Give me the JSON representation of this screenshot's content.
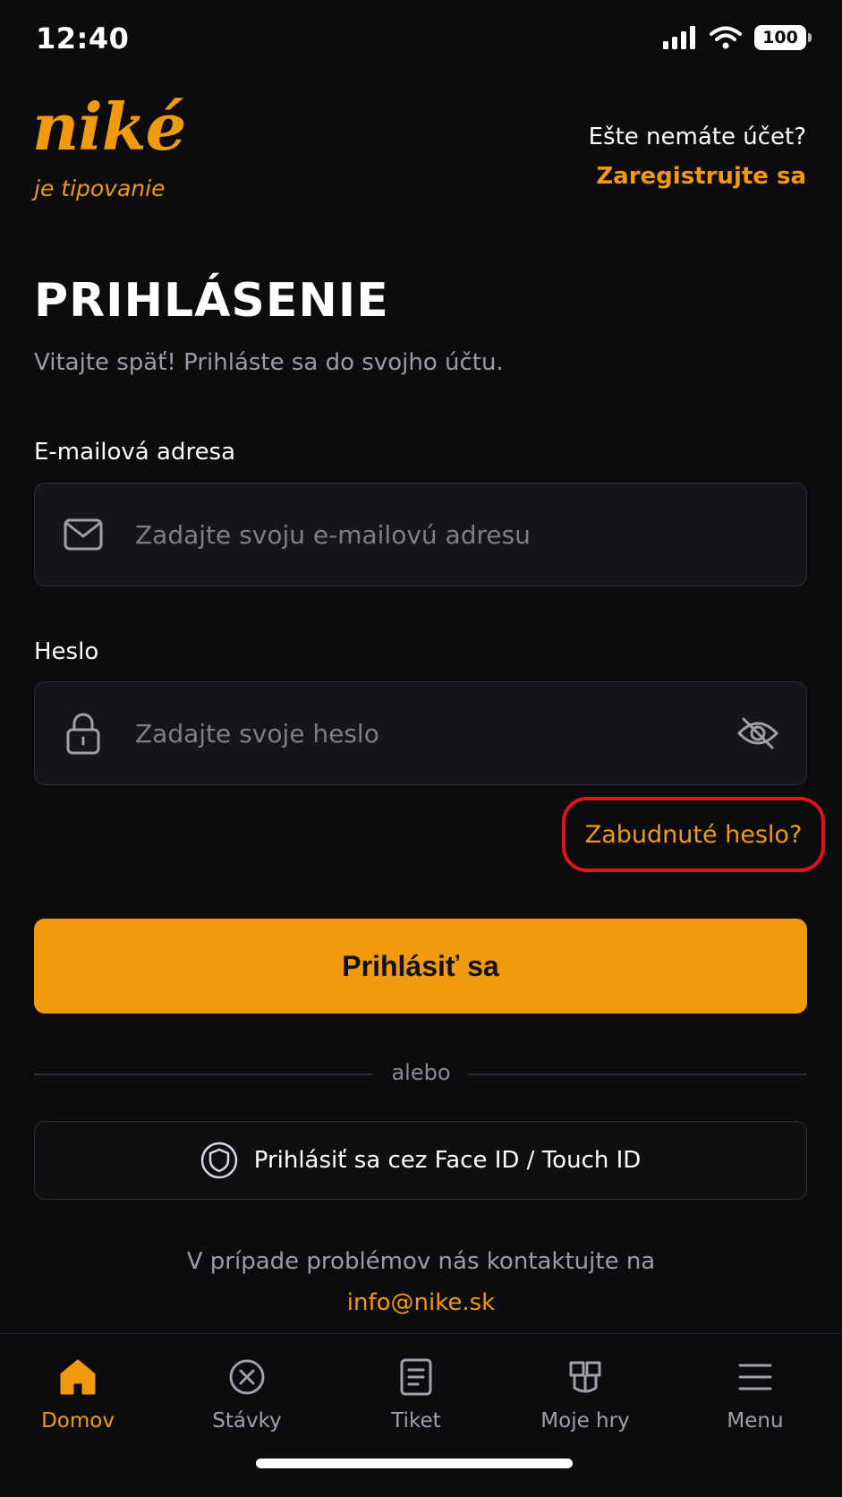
{
  "status_bar": {
    "time": "12:40",
    "battery": "100"
  },
  "header": {
    "logo": "niké",
    "logo_tagline": "je tipovanie",
    "no_account": "Ešte nemáte účet?",
    "register": "Zaregistrujte sa"
  },
  "login": {
    "title": "PRIHLÁSENIE",
    "subtitle": "Vitajte späť! Prihláste sa do svojho účtu.",
    "email_label": "E-mailová adresa",
    "email_placeholder": "Zadajte svoju e-mailovú adresu",
    "password_label": "Heslo",
    "password_placeholder": "Zadajte svoje heslo",
    "forgot_password": "Zabudnuté heslo?",
    "submit": "Prihlásiť sa",
    "divider": "alebo",
    "biometric": "Prihlásiť sa cez Face ID / Touch ID",
    "contact_text": "V prípade problémov nás kontaktujte na",
    "contact_email": "info@nike.sk"
  },
  "nav": {
    "items": [
      {
        "label": "Domov",
        "icon": "home-icon",
        "active": true
      },
      {
        "label": "Stávky",
        "icon": "close-circle-icon",
        "active": false
      },
      {
        "label": "Tiket",
        "icon": "ticket-icon",
        "active": false
      },
      {
        "label": "Moje hry",
        "icon": "games-icon",
        "active": false
      },
      {
        "label": "Menu",
        "icon": "menu-icon",
        "active": false
      }
    ]
  },
  "colors": {
    "accent": "#f29a0e",
    "background": "#0c0c0f",
    "field_bg": "#16161a",
    "highlight": "#e0121a"
  }
}
